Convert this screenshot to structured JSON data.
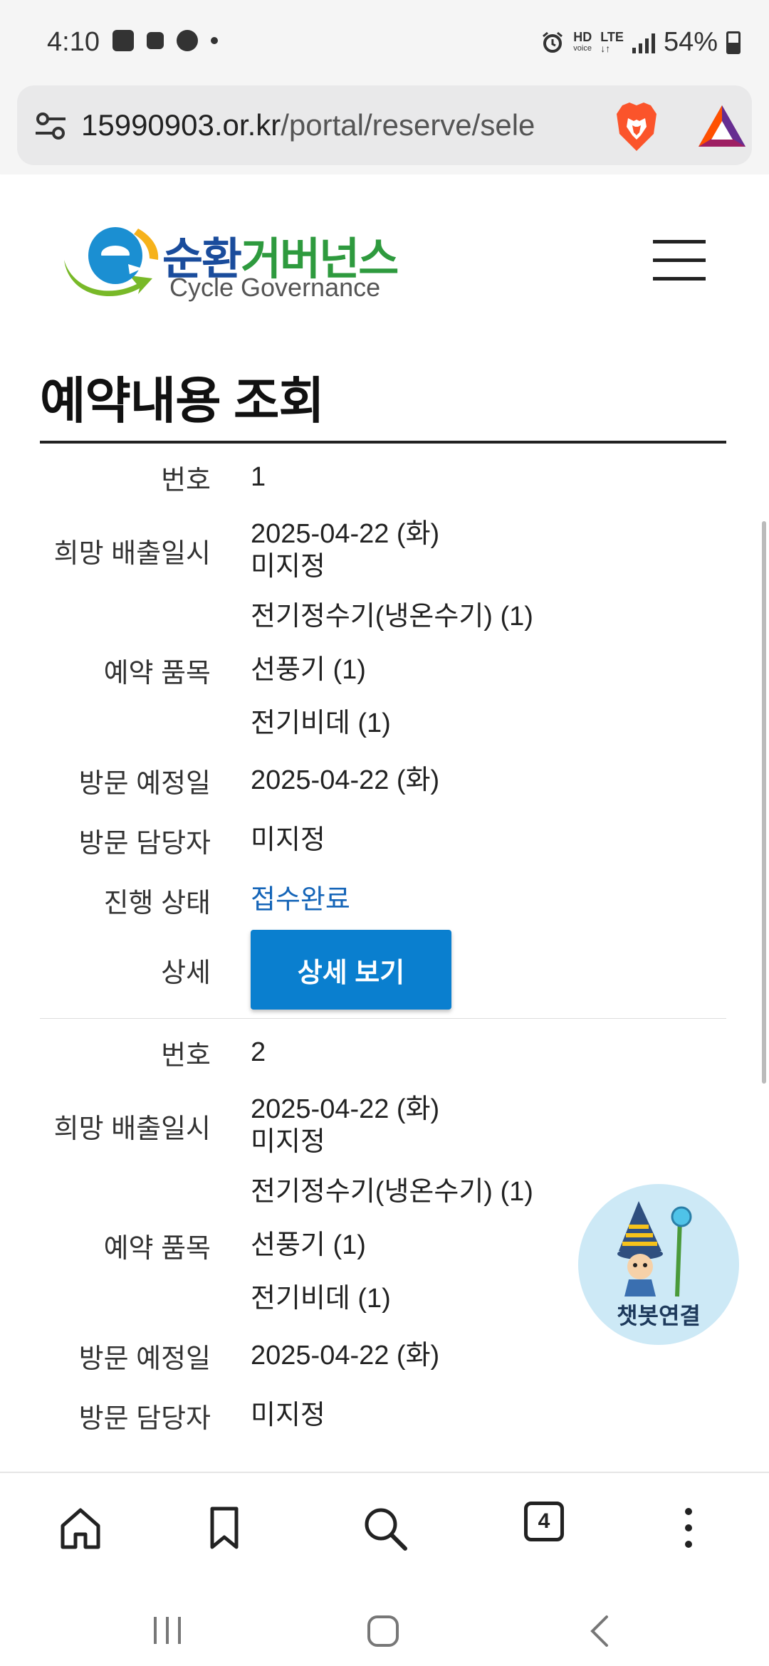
{
  "status_bar": {
    "time": "4:10",
    "battery": "54%",
    "hd": "HD",
    "voice": "voice",
    "lte": "LTE"
  },
  "browser": {
    "url_domain": "15990903.or.kr",
    "url_path": "/portal/reserve/sele",
    "tab_count": "4"
  },
  "logo": {
    "korean_part1": "순환",
    "korean_part2": "거버넌스",
    "english": "Cycle Governance"
  },
  "page": {
    "title": "예약내용 조회"
  },
  "labels": {
    "number": "번호",
    "desired_date": "희망 배출일시",
    "items": "예약 품목",
    "visit_date": "방문 예정일",
    "visit_staff": "방문 담당자",
    "status": "진행 상태",
    "detail": "상세",
    "detail_button": "상세 보기"
  },
  "records": [
    {
      "number": "1",
      "desired_date": "2025-04-22 (화)",
      "desired_time": "미지정",
      "items": [
        "전기정수기(냉온수기) (1)",
        "선풍기 (1)",
        "전기비데 (1)"
      ],
      "visit_date": "2025-04-22 (화)",
      "visit_staff": "미지정",
      "status": "접수완료"
    },
    {
      "number": "2",
      "desired_date": "2025-04-22 (화)",
      "desired_time": "미지정",
      "items": [
        "전기정수기(냉온수기) (1)",
        "선풍기 (1)",
        "전기비데 (1)"
      ],
      "visit_date": "2025-04-22 (화)",
      "visit_staff": "미지정"
    }
  ],
  "chatbot": {
    "label": "챗봇연결"
  },
  "colors": {
    "status_text": "#1565b8",
    "button_bg": "#0a7fcf",
    "chatbot_bg": "#cde9f6"
  }
}
